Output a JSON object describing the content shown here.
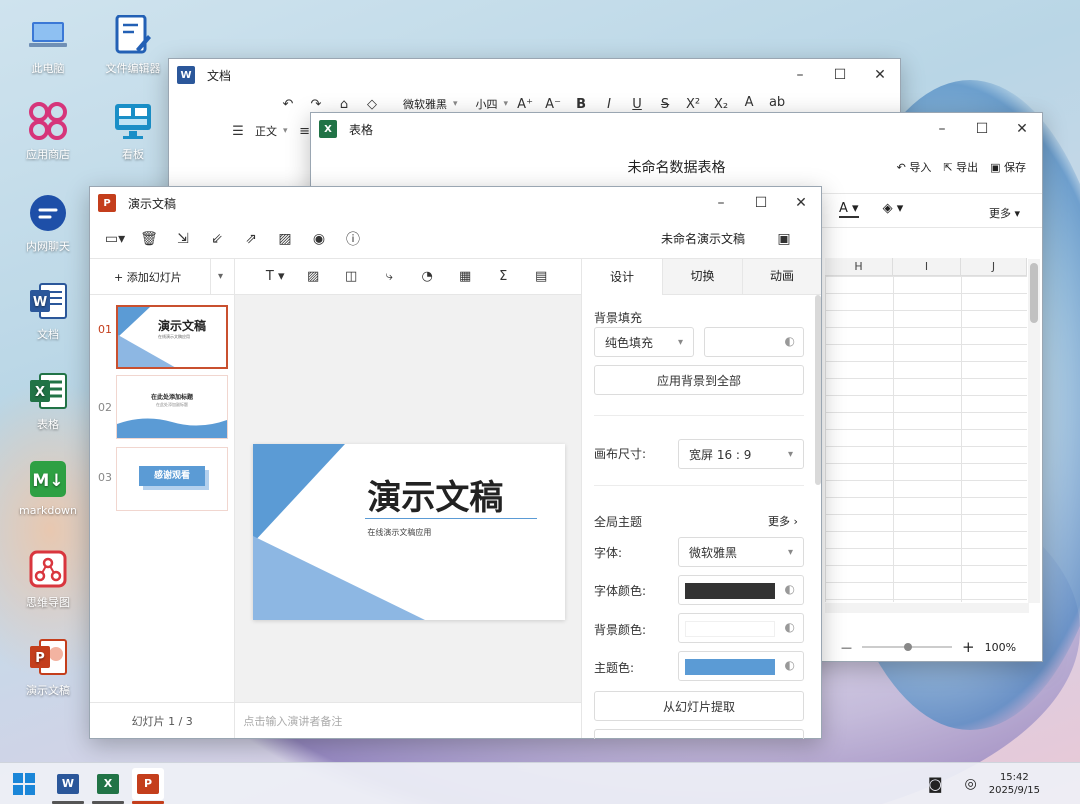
{
  "desktop": {
    "icons": [
      {
        "label": "此电脑",
        "icon": "computer-icon"
      },
      {
        "label": "文件编辑器",
        "icon": "file-editor-icon"
      },
      {
        "label": "应用商店",
        "icon": "app-store-icon"
      },
      {
        "label": "看板",
        "icon": "kanban-icon"
      },
      {
        "label": "内网聊天",
        "icon": "chat-icon"
      },
      {
        "label": "文档",
        "icon": "word-icon"
      },
      {
        "label": "表格",
        "icon": "excel-icon"
      },
      {
        "label": "markdown",
        "icon": "markdown-icon"
      },
      {
        "label": "思维导图",
        "icon": "mindmap-icon"
      },
      {
        "label": "演示文稿",
        "icon": "ppt-icon"
      }
    ]
  },
  "word": {
    "title": "文档",
    "font": "微软雅黑",
    "size": "小四",
    "style": "正文"
  },
  "excel": {
    "title": "表格",
    "sheet_title": "未命名数据表格",
    "import": "导入",
    "export": "导出",
    "save": "保存",
    "more": "更多",
    "columns": [
      "H",
      "I",
      "J"
    ],
    "zoom": "100%"
  },
  "ppt": {
    "title": "演示文稿",
    "doc_name": "未命名演示文稿",
    "add_slide": "添加幻灯片",
    "slide_count": "幻灯片 1 / 3",
    "notes_placeholder": "点击输入演讲者备注",
    "slides": [
      {
        "num": "01",
        "title": "演示文稿",
        "subtitle": "在线演示文稿应用"
      },
      {
        "num": "02",
        "title": "在此处添加标题",
        "subtitle": "在此处添加副标题"
      },
      {
        "num": "03",
        "title": "感谢观看"
      }
    ],
    "canvas": {
      "title": "演示文稿",
      "subtitle": "在线演示文稿应用"
    },
    "tabs": [
      "设计",
      "切换",
      "动画"
    ],
    "design": {
      "bg_fill_label": "背景填充",
      "bg_fill_value": "纯色填充",
      "apply_all": "应用背景到全部",
      "canvas_size_label": "画布尺寸:",
      "canvas_size_value": "宽屏 16 : 9",
      "theme_label": "全局主题",
      "more": "更多",
      "font_label": "字体:",
      "font_value": "微软雅黑",
      "font_color_label": "字体颜色:",
      "bg_color_label": "背景颜色:",
      "theme_color_label": "主题色:",
      "extract": "从幻灯片提取"
    },
    "colors": {
      "font": "#333333",
      "bg": "#ffffff",
      "theme": "#5b9bd5"
    }
  },
  "taskbar": {
    "time": "15:42",
    "date": "2025/9/15"
  }
}
